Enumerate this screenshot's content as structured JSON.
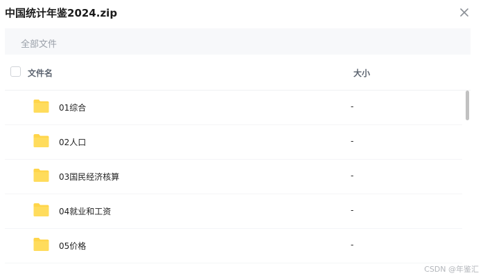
{
  "window": {
    "title": "中国统计年鉴2024.zip",
    "close_icon": "close-icon"
  },
  "breadcrumb": {
    "label": "全部文件"
  },
  "table": {
    "columns": {
      "name": "文件名",
      "size": "大小"
    },
    "rows": [
      {
        "name": "01综合",
        "size": "-",
        "icon": "folder-icon"
      },
      {
        "name": "02人口",
        "size": "-",
        "icon": "folder-icon"
      },
      {
        "name": "03国民经济核算",
        "size": "-",
        "icon": "folder-icon"
      },
      {
        "name": "04就业和工资",
        "size": "-",
        "icon": "folder-icon"
      },
      {
        "name": "05价格",
        "size": "-",
        "icon": "folder-icon"
      }
    ]
  },
  "watermark": "CSDN @年鉴汇",
  "colors": {
    "folder": "#ffd54a",
    "breadcrumb_bg": "#f7f8fa"
  }
}
